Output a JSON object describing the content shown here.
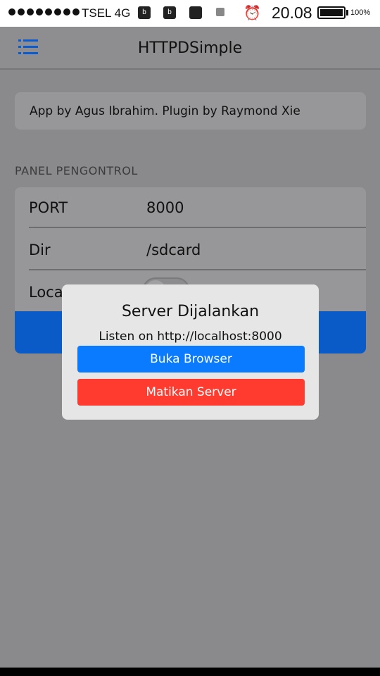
{
  "status_bar": {
    "carrier": "TSEL 4G",
    "time": "20.08",
    "battery_percent": "100%",
    "battery_level": 1.0,
    "signal_bars": 8,
    "icons": [
      "bbm-icon",
      "bbm-icon",
      "screen-icon",
      "lock-icon",
      "alarm-icon"
    ]
  },
  "header": {
    "title": "HTTPDSimple",
    "menu_icon": "list-menu-icon"
  },
  "credit": {
    "text": "App by Agus Ibrahim. Plugin by Raymond Xie"
  },
  "panel": {
    "section_label": "PANEL PENGONTROL",
    "rows": [
      {
        "label": "PORT",
        "value": "8000"
      },
      {
        "label": "Dir",
        "value": "/sdcard"
      },
      {
        "label": "Local",
        "value": ""
      }
    ],
    "toggle_on": false
  },
  "dialog": {
    "title": "Server Dijalankan",
    "message": "Listen on http://localhost:8000",
    "open_button": "Buka Browser",
    "stop_button": "Matikan Server"
  },
  "colors": {
    "accent": "#0a7bff",
    "danger": "#ff3b30",
    "primary_button": "#0a5bc8"
  }
}
